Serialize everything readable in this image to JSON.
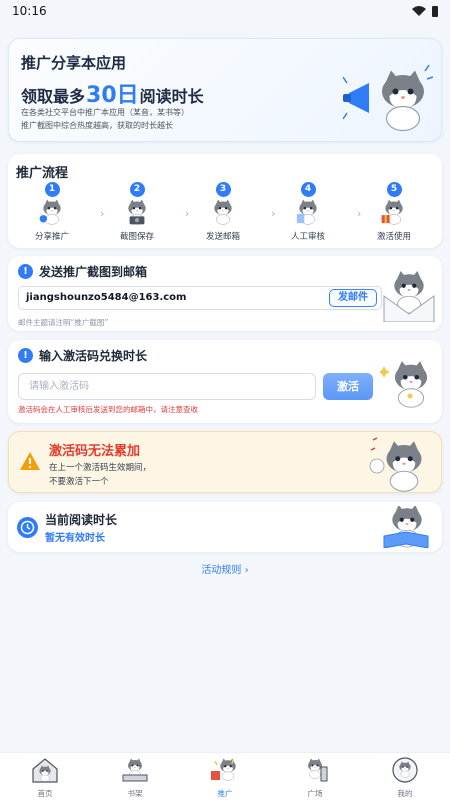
{
  "status": {
    "time": "10:16"
  },
  "hero": {
    "title_line1": "推广分享本应用",
    "title_line2_prefix": "领取最多",
    "title_line2_number": "30日",
    "title_line2_suffix": "阅读时长",
    "subtitle_line1": "在各类社交平台中推广本应用（某音，某书等）",
    "subtitle_line2": "推广截图中综合热度越高，获取的时长越长"
  },
  "flow": {
    "title": "推广流程",
    "steps": [
      {
        "num": "1",
        "label": "分享推广"
      },
      {
        "num": "2",
        "label": "截图保存"
      },
      {
        "num": "3",
        "label": "发送邮箱"
      },
      {
        "num": "4",
        "label": "人工审核"
      },
      {
        "num": "5",
        "label": "激活使用"
      }
    ],
    "arrow": "›"
  },
  "email": {
    "alert": "!",
    "title": "发送推广截图到邮箱",
    "address": "jiangshounzo5484@163.com",
    "send_button": "发邮件",
    "hint": "邮件主题请注明“推广截图”"
  },
  "code": {
    "alert": "!",
    "title": "输入激活码兑换时长",
    "placeholder": "请输入激活码",
    "activate_button": "激活",
    "notice": "激活码会在人工审核后发送到您的邮箱中，请注意查收"
  },
  "warning": {
    "title": "激活码无法累加",
    "line1": "在上一个激活码生效期间，",
    "line2": "不要激活下一个"
  },
  "reading": {
    "title": "当前阅读时长",
    "value": "暂无有效时长"
  },
  "rules_link": "活动规则 ›",
  "tabs": [
    {
      "label": "首页",
      "active": false
    },
    {
      "label": "书架",
      "active": false
    },
    {
      "label": "推广",
      "active": true
    },
    {
      "label": "广场",
      "active": false
    },
    {
      "label": "我的",
      "active": false
    }
  ],
  "colors": {
    "accent": "#2f7cf6",
    "danger": "#e63b2e",
    "warning_bg": "#fef6e4",
    "page_bg": "#f3f6fb"
  }
}
